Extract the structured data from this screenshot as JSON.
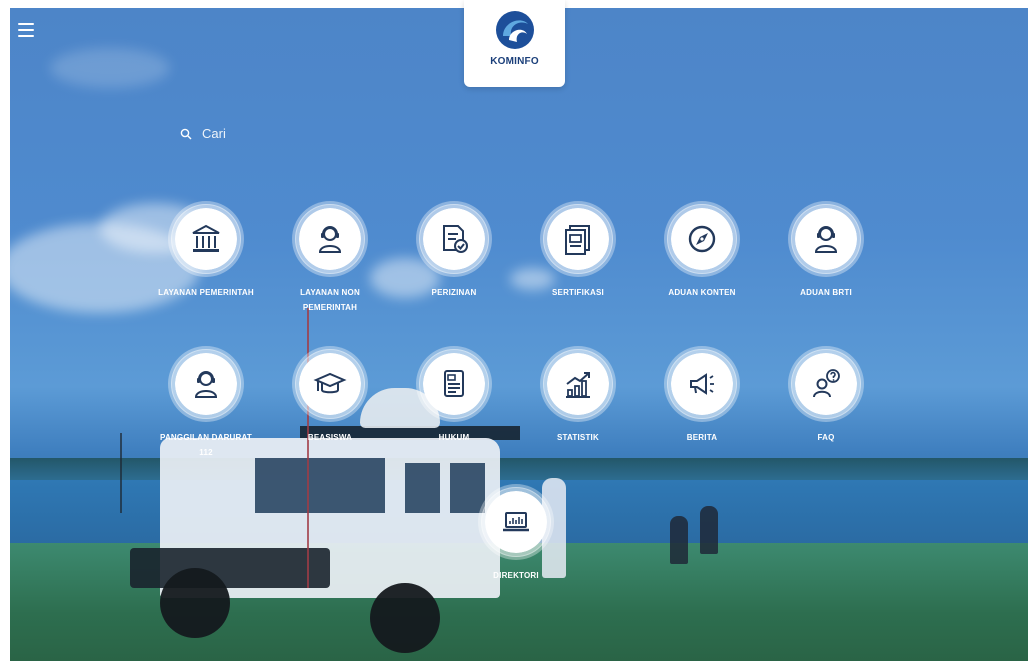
{
  "logo": {
    "text": "KOMINFO",
    "icon": "kominfo-logo"
  },
  "search": {
    "placeholder": "Cari",
    "icon": "search-icon"
  },
  "menu": {
    "icon": "hamburger-menu-icon"
  },
  "colors": {
    "accent": "#23395b",
    "logo_blue": "#1b3f7a",
    "tile_bg": "#ffffff"
  },
  "services": [
    {
      "label": "LAYANAN PEMERINTAH",
      "icon": "government-building-icon"
    },
    {
      "label": "LAYANAN NON PEMERINTAH",
      "icon": "operator-headset-icon"
    },
    {
      "label": "PERIZINAN",
      "icon": "license-document-check-icon"
    },
    {
      "label": "SERTIFIKASI",
      "icon": "certificate-icon"
    },
    {
      "label": "ADUAN KONTEN",
      "icon": "compass-icon"
    },
    {
      "label": "ADUAN BRTI",
      "icon": "operator-headset-icon"
    },
    {
      "label": "PANGGILAN DARURAT 112",
      "icon": "operator-headset-icon"
    },
    {
      "label": "BEASISWA",
      "icon": "graduation-cap-icon"
    },
    {
      "label": "HUKUM",
      "icon": "law-document-icon"
    },
    {
      "label": "STATISTIK",
      "icon": "growth-chart-icon"
    },
    {
      "label": "BERITA",
      "icon": "megaphone-icon"
    },
    {
      "label": "FAQ",
      "icon": "user-question-icon"
    },
    {
      "label": "DIREKTORI",
      "icon": "laptop-chart-icon"
    }
  ]
}
